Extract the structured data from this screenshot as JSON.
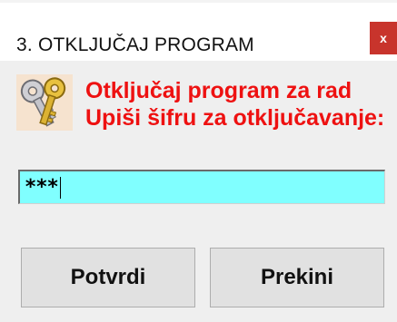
{
  "window": {
    "title": "3. OTKLJUČAJ PROGRAM",
    "close_label": "x"
  },
  "message": {
    "line1": "Otključaj program za rad",
    "line2": "Upiši šifru za otključavanje:",
    "color": "#ee1111",
    "icon": "keys-icon"
  },
  "password": {
    "value": "***",
    "background": "#80ffff"
  },
  "buttons": {
    "ok_label": "Potvrdi",
    "cancel_label": "Prekini"
  }
}
